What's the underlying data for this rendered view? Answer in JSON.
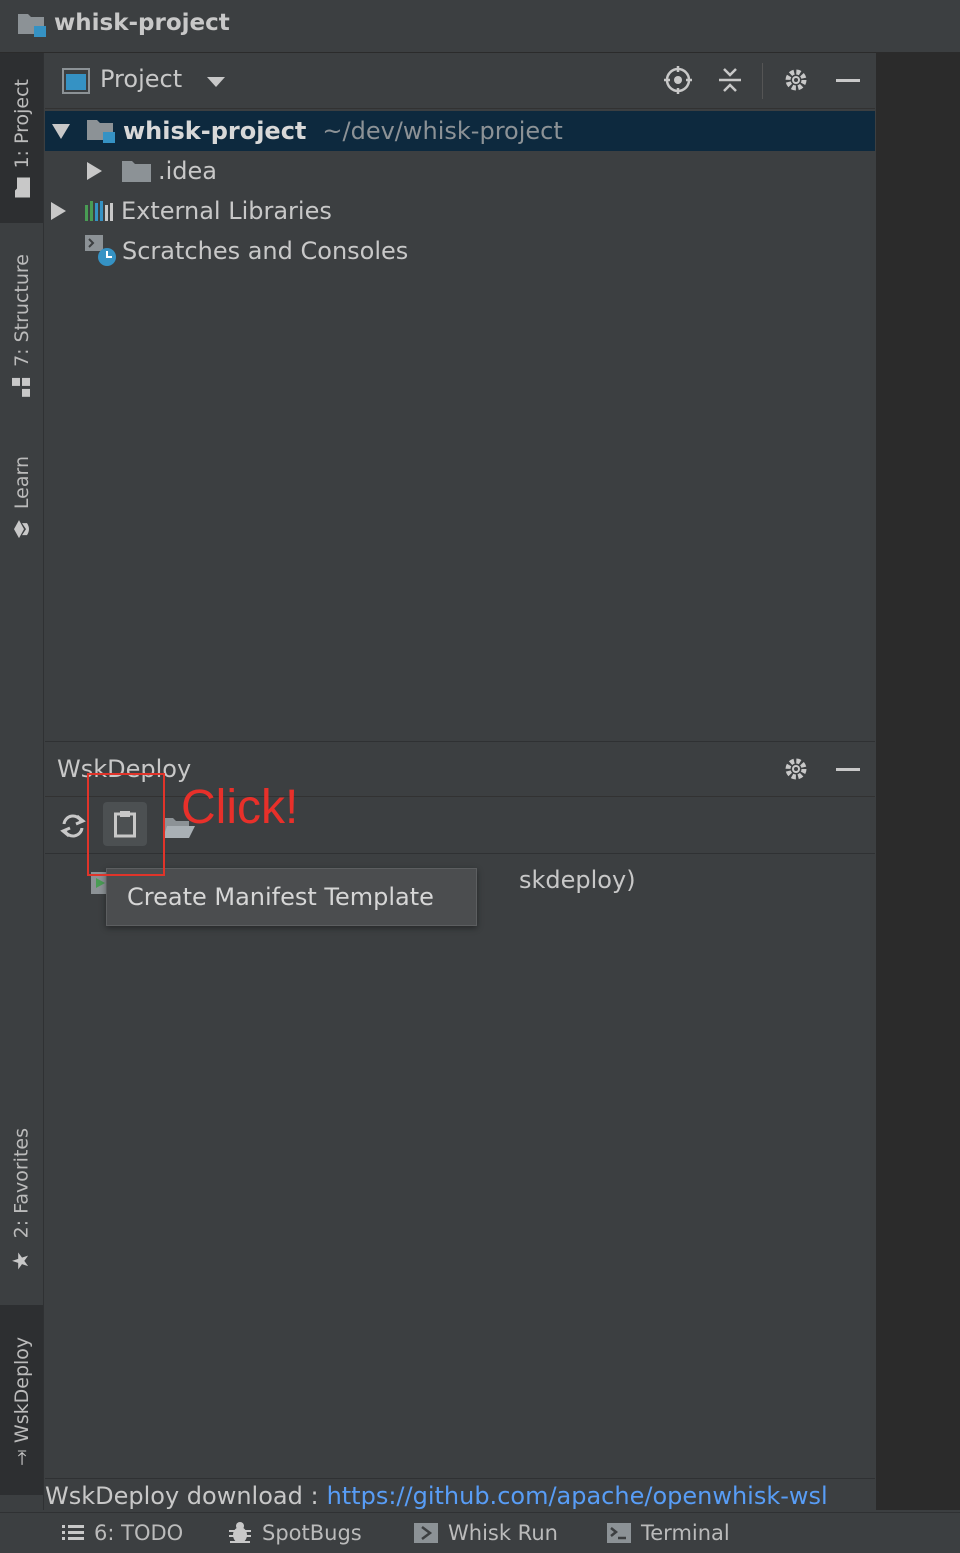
{
  "window": {
    "title": "whisk-project"
  },
  "left_tabs": [
    {
      "label": "1: Project"
    },
    {
      "label": "7: Structure"
    },
    {
      "label": "Learn"
    },
    {
      "label": "2: Favorites"
    },
    {
      "label": "WskDeploy"
    }
  ],
  "project_panel": {
    "title": "Project",
    "tree": [
      {
        "label": "whisk-project",
        "path": "~/dev/whisk-project"
      },
      {
        "label": ".idea"
      },
      {
        "label": "External Libraries"
      },
      {
        "label": "Scratches and Consoles"
      }
    ]
  },
  "wskdeploy_panel": {
    "title": "WskDeploy",
    "tree_item_partial": "skdeploy)",
    "tooltip": "Create Manifest Template",
    "annotation": "Click!"
  },
  "download_bar": {
    "label": "WskDeploy download :",
    "link": "https://github.com/apache/openwhisk-wsl"
  },
  "bottom_tabs": [
    {
      "label": "6: TODO"
    },
    {
      "label": "SpotBugs"
    },
    {
      "label": "Whisk Run"
    },
    {
      "label": "Terminal"
    }
  ],
  "colors": {
    "background": "#3c3f41",
    "selection": "#0d293e",
    "link": "#589df6",
    "annotation_red": "#e0342a"
  }
}
